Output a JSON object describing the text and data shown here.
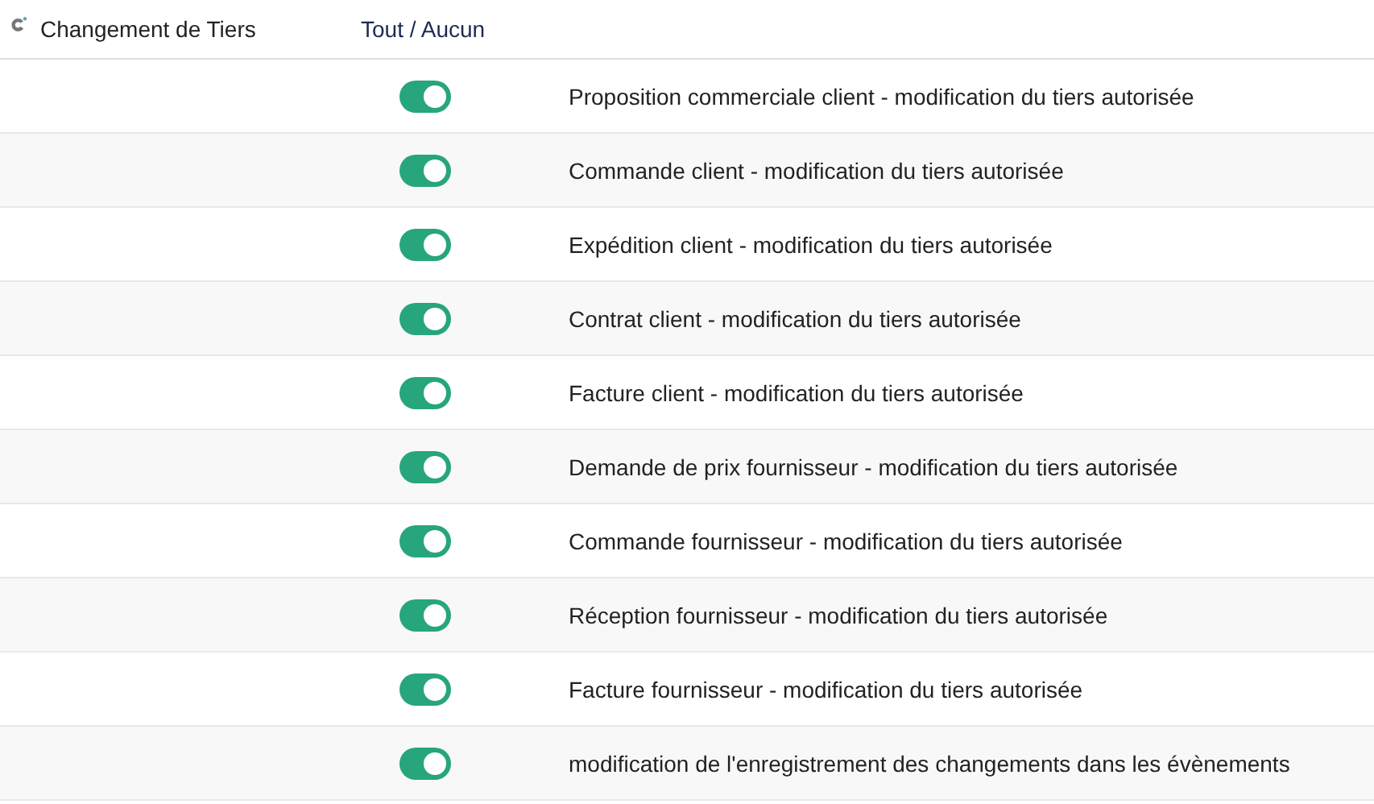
{
  "header": {
    "title": "Changement de Tiers",
    "toggle_all": "Tout / Aucun"
  },
  "rows": [
    {
      "label": "Proposition commerciale client - modification du tiers autorisée",
      "on": true
    },
    {
      "label": "Commande client - modification du tiers autorisée",
      "on": true
    },
    {
      "label": "Expédition client - modification du tiers autorisée",
      "on": true
    },
    {
      "label": "Contrat client - modification du tiers autorisée",
      "on": true
    },
    {
      "label": "Facture client - modification du tiers autorisée",
      "on": true
    },
    {
      "label": "Demande de prix fournisseur - modification du tiers autorisée",
      "on": true
    },
    {
      "label": "Commande fournisseur - modification du tiers autorisée",
      "on": true
    },
    {
      "label": "Réception fournisseur - modification du tiers autorisée",
      "on": true
    },
    {
      "label": "Facture fournisseur - modification du tiers autorisée",
      "on": true
    },
    {
      "label": "modification de l'enregistrement des changements dans les évènements",
      "on": true
    }
  ]
}
